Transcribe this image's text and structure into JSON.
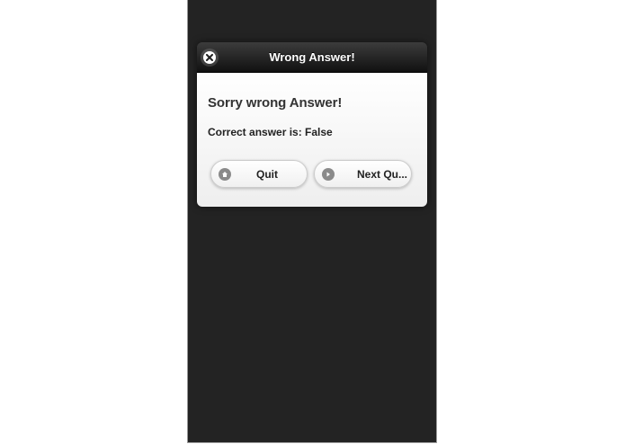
{
  "dialog": {
    "title": "Wrong Answer!",
    "close_icon": "close-icon",
    "heading": "Sorry wrong Answer!",
    "answer_text": "Correct answer is: False"
  },
  "buttons": {
    "quit": {
      "label": "Quit",
      "icon": "home-icon"
    },
    "next": {
      "label": "Next Qu...",
      "icon": "arrow-right-icon"
    }
  },
  "colors": {
    "screen_background": "#232323",
    "header_background": "#1c1c1c",
    "body_background": "#f5f5f5",
    "button_icon": "#8a8a8a"
  }
}
